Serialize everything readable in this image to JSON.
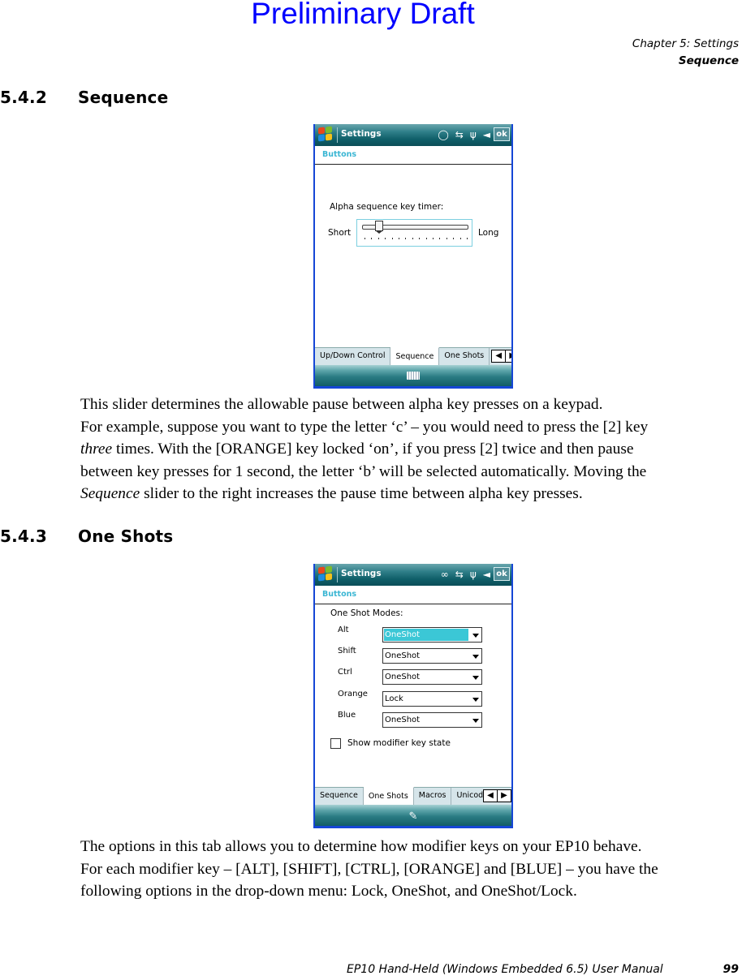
{
  "watermark": "Preliminary Draft",
  "running_head": {
    "chapter": "Chapter 5:  Settings",
    "section": "Sequence"
  },
  "sections": [
    {
      "number": "5.4.2",
      "title": "Sequence",
      "paragraphs": [
        "This slider determines the allowable pause between alpha key presses on a keypad.",
        "For example, suppose you want to type the letter ‘c’ – you would need to press the [2] key",
        "times. With the [ORANGE] key locked ‘on’, if you press [2] twice and then pause",
        "between key presses for 1 second, the letter ‘b’ will be selected automatically. Moving the",
        "slider to the right increases the pause time between alpha key presses."
      ],
      "italic_words": [
        "three",
        "Sequence"
      ]
    },
    {
      "number": "5.4.3",
      "title": "One Shots",
      "paragraphs": [
        "The options in this tab allows you to determine how modifier keys on your EP10 behave.",
        "For each modifier key – [ALT], [SHIFT], [CTRL], [ORANGE] and [BLUE] – you have the",
        "following options in the drop-down menu: Lock, OneShot, and OneShot/Lock."
      ]
    }
  ],
  "screen_sequence": {
    "titlebar": {
      "app_title": "Settings",
      "icons": [
        "windows-start-icon",
        "speech-bubble-icon",
        "sync-arrows-icon",
        "signal-icon",
        "speaker-icon"
      ],
      "ok_label": "ok"
    },
    "subheader": "Buttons",
    "slider": {
      "label": "Alpha sequence key timer:",
      "min_label": "Short",
      "max_label": "Long",
      "tick_count": 16,
      "value_fraction": 0.133
    },
    "tabs": [
      {
        "label": "Up/Down Control",
        "active": false
      },
      {
        "label": "Sequence",
        "active": true
      },
      {
        "label": "One Shots",
        "active": false
      }
    ],
    "bottom_icon": "keyboard-icon"
  },
  "screen_oneshots": {
    "titlebar": {
      "app_title": "Settings",
      "icons": [
        "windows-start-icon",
        "voicemail-icon",
        "sync-arrows-icon",
        "signal-icon",
        "speaker-icon"
      ],
      "ok_label": "ok"
    },
    "subheader": "Buttons",
    "modes_title": "One Shot Modes:",
    "modifiers": [
      {
        "label": "Alt",
        "value": "OneShot",
        "highlighted": true
      },
      {
        "label": "Shift",
        "value": "OneShot",
        "highlighted": false
      },
      {
        "label": "Ctrl",
        "value": "OneShot",
        "highlighted": false
      },
      {
        "label": "Orange",
        "value": "Lock",
        "highlighted": false
      },
      {
        "label": "Blue",
        "value": "OneShot",
        "highlighted": false
      }
    ],
    "checkbox": {
      "label": "Show modifier key state",
      "checked": false
    },
    "tabs": [
      {
        "label": "Sequence",
        "active": false
      },
      {
        "label": "One Shots",
        "active": true
      },
      {
        "label": "Macros",
        "active": false
      },
      {
        "label": "Unicode M",
        "active": false
      }
    ],
    "bottom_icon": "input-pen-icon"
  },
  "footer": {
    "manual_title": "EP10 Hand-Held (Windows Embedded 6.5) User Manual",
    "page_number": "99"
  }
}
